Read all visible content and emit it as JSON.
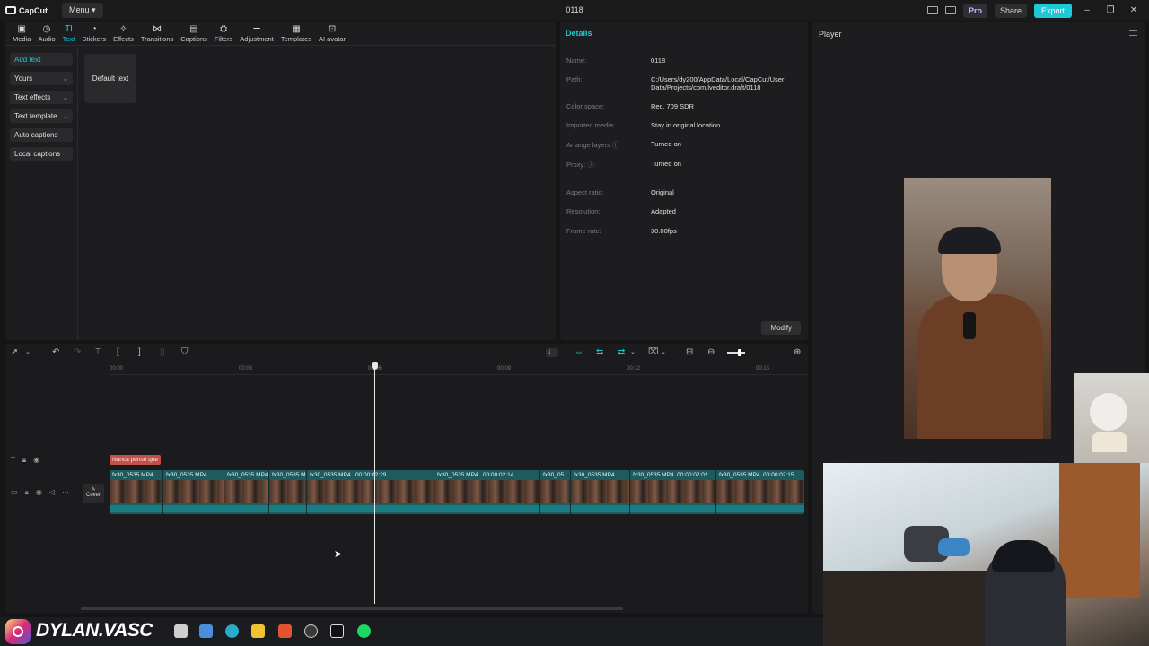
{
  "titlebar": {
    "app_name": "CapCut",
    "menu_label": "Menu",
    "project_title": "0118",
    "pro_label": "Pro",
    "share_label": "Share",
    "export_label": "Export",
    "accent": "#1fc8d6"
  },
  "toolbar": {
    "tabs": [
      {
        "label": "Media",
        "icon": "media-icon"
      },
      {
        "label": "Audio",
        "icon": "audio-icon"
      },
      {
        "label": "Text",
        "icon": "text-icon",
        "active": true
      },
      {
        "label": "Stickers",
        "icon": "stickers-icon"
      },
      {
        "label": "Effects",
        "icon": "effects-icon"
      },
      {
        "label": "Transitions",
        "icon": "transitions-icon"
      },
      {
        "label": "Captions",
        "icon": "captions-icon"
      },
      {
        "label": "Filters",
        "icon": "filters-icon"
      },
      {
        "label": "Adjustment",
        "icon": "adjustment-icon"
      },
      {
        "label": "Templates",
        "icon": "templates-icon"
      },
      {
        "label": "AI avatar",
        "icon": "ai-avatar-icon"
      }
    ]
  },
  "sidebar": {
    "items": [
      {
        "label": "Add text",
        "active": true
      },
      {
        "label": "Yours",
        "chevron": true
      },
      {
        "label": "Text effects",
        "chevron": true
      },
      {
        "label": "Text template",
        "chevron": true
      },
      {
        "label": "Auto captions"
      },
      {
        "label": "Local captions"
      }
    ],
    "card_label": "Default text"
  },
  "details": {
    "title": "Details",
    "rows": [
      {
        "label": "Name:",
        "value": "0118"
      },
      {
        "label": "Path:",
        "value": "C:/Users/dy200/AppData/Local/CapCut/User Data/Projects/com.lveditor.draft/0118"
      },
      {
        "label": "Color space:",
        "value": "Rec. 709 SDR"
      },
      {
        "label": "Imported media:",
        "value": "Stay in original location"
      },
      {
        "label": "Arrange layers ⓘ",
        "value": "Turned on"
      },
      {
        "label": "Proxy: ⓘ",
        "value": "Turned on"
      },
      {
        "label": "Aspect ratio:",
        "value": "Original"
      },
      {
        "label": "Resolution:",
        "value": "Adapted"
      },
      {
        "label": "Frame rate:",
        "value": "30.00fps"
      }
    ],
    "modify_label": "Modify"
  },
  "player": {
    "title": "Player"
  },
  "timeline": {
    "ticks": [
      "00:00",
      "00:03",
      "00:06",
      "00:09",
      "00:12",
      "00:15"
    ],
    "caption_clip": "Nunca pensé que",
    "cover_label": "Cover",
    "clips": [
      {
        "label": "fx30_0535.MP4",
        "duration": ""
      },
      {
        "label": "fx30_0535.MP4",
        "duration": ""
      },
      {
        "label": "fx30_0535.MP4",
        "duration": ""
      },
      {
        "label": "fx30_0535.M",
        "duration": ""
      },
      {
        "label": "fx30_0535.MP4",
        "duration": "00:00:02:29"
      },
      {
        "label": "fx30_0535.MP4",
        "duration": "00:00:02:14"
      },
      {
        "label": "fx30_05",
        "duration": ""
      },
      {
        "label": "fx30_0535.MP4",
        "duration": ""
      },
      {
        "label": "fx30_0535.MP4",
        "duration": "00:00:02:02"
      },
      {
        "label": "fx30_0535.MP4",
        "duration": "00:00:02:15"
      }
    ]
  },
  "overlay": {
    "handle": "DYLAN.VASC"
  }
}
